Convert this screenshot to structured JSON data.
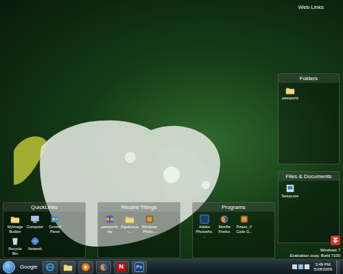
{
  "desktop": {
    "web_links": "Web Links"
  },
  "fences": [
    {
      "title": "QuickLinks",
      "place": "bottom",
      "items": [
        {
          "label": "MyImage Builder",
          "kind": "folder"
        },
        {
          "label": "Computer",
          "kind": "computer"
        },
        {
          "label": "Control Panel",
          "kind": "control"
        },
        {
          "label": "Recycle Bin",
          "kind": "bin"
        },
        {
          "label": "Network",
          "kind": "network"
        }
      ]
    },
    {
      "title": "Recent Things",
      "place": "bottom",
      "items": [
        {
          "label": "passports.zip",
          "kind": "zip"
        },
        {
          "label": "Dgelicious-...",
          "kind": "folder"
        },
        {
          "label": "Windows Photo...",
          "kind": "app"
        }
      ]
    },
    {
      "title": "Programs",
      "place": "bottom",
      "items": [
        {
          "label": "Adobe Photosho...",
          "kind": "photoshop"
        },
        {
          "label": "Mozilla Firefox",
          "kind": "firefox"
        },
        {
          "label": "Power_V Code G...",
          "kind": "app"
        }
      ]
    },
    {
      "title": "Folders",
      "place": "right-top",
      "items": [
        {
          "label": "passports",
          "kind": "folder"
        }
      ]
    },
    {
      "title": "Files & Documents",
      "place": "right-bottom",
      "items": [
        {
          "label": "Setup.exe",
          "kind": "setup"
        }
      ]
    }
  ],
  "watermark": [
    "Windows 7",
    "Evaluation copy. Build 7100"
  ],
  "taskbar": {
    "search": "Google",
    "apps": [
      {
        "kind": "ie",
        "glyph": ""
      },
      {
        "kind": "explorer",
        "glyph": ""
      },
      {
        "kind": "media",
        "glyph": ""
      },
      {
        "kind": "firefox",
        "glyph": ""
      },
      {
        "kind": "netflix",
        "glyph": "N"
      },
      {
        "kind": "photoshop",
        "glyph": "Ps"
      }
    ],
    "time": "3:49 PM",
    "date": "5/28/2009"
  }
}
